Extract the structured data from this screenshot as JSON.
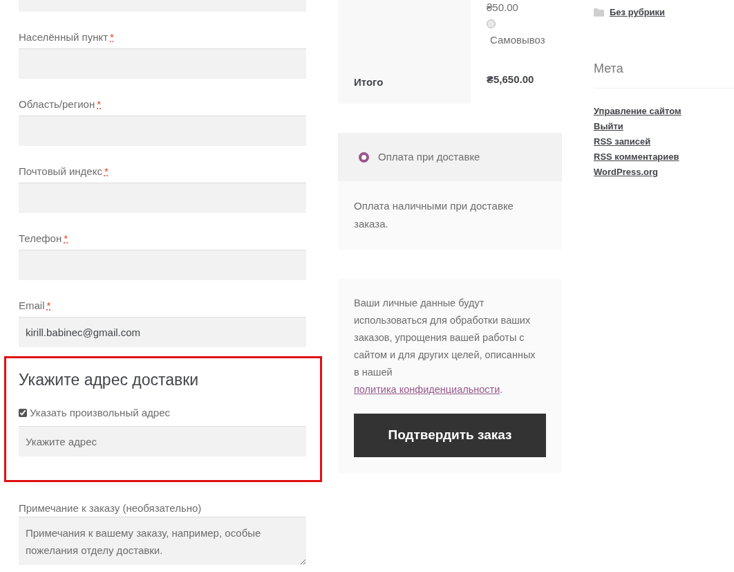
{
  "billing": {
    "fields": [
      {
        "label": "Населённый пункт",
        "required_mark": "*"
      },
      {
        "label": "Область/регион",
        "required_mark": "*"
      },
      {
        "label": "Почтовый индекс",
        "required_mark": "*"
      },
      {
        "label": "Телефон",
        "required_mark": "*"
      },
      {
        "label": "Email",
        "required_mark": "*",
        "value": "kirill.babinec@gmail.com"
      }
    ]
  },
  "shipping": {
    "heading": "Укажите адрес доставки",
    "checkbox": {
      "label": "Указать произвольный адрес",
      "checked": true
    },
    "address": {
      "placeholder": "Укажите адрес"
    }
  },
  "order_note": {
    "label": "Примечание к заказу (необязательно)",
    "placeholder": "Примечания к вашему заказу, например, особые пожелания отделу доставки."
  },
  "order_summary": {
    "shipping_price": "₴50.00",
    "shipping_options": [
      {
        "label": "Самовывоз",
        "selected": false
      }
    ],
    "total_label": "Итого",
    "total_value": "₴5,650.00"
  },
  "payment": {
    "methods": [
      {
        "label": "Оплата при доставке",
        "selected": true
      }
    ],
    "description": "Оплата наличными при доставке заказа."
  },
  "privacy": {
    "text": "Ваши личные данные будут использоваться для обработки ваших заказов, упрощения вашей работы с сайтом и для других целей, описанных в нашей",
    "link": "политика конфиденциальности",
    "end": ".",
    "button": "Подтвердить заказ"
  },
  "sidebar": {
    "category": "Без рубрики",
    "meta_heading": "Мета",
    "meta_links": [
      "Управление сайтом",
      "Выйти",
      "RSS записей",
      "RSS комментариев",
      "WordPress.org"
    ]
  }
}
